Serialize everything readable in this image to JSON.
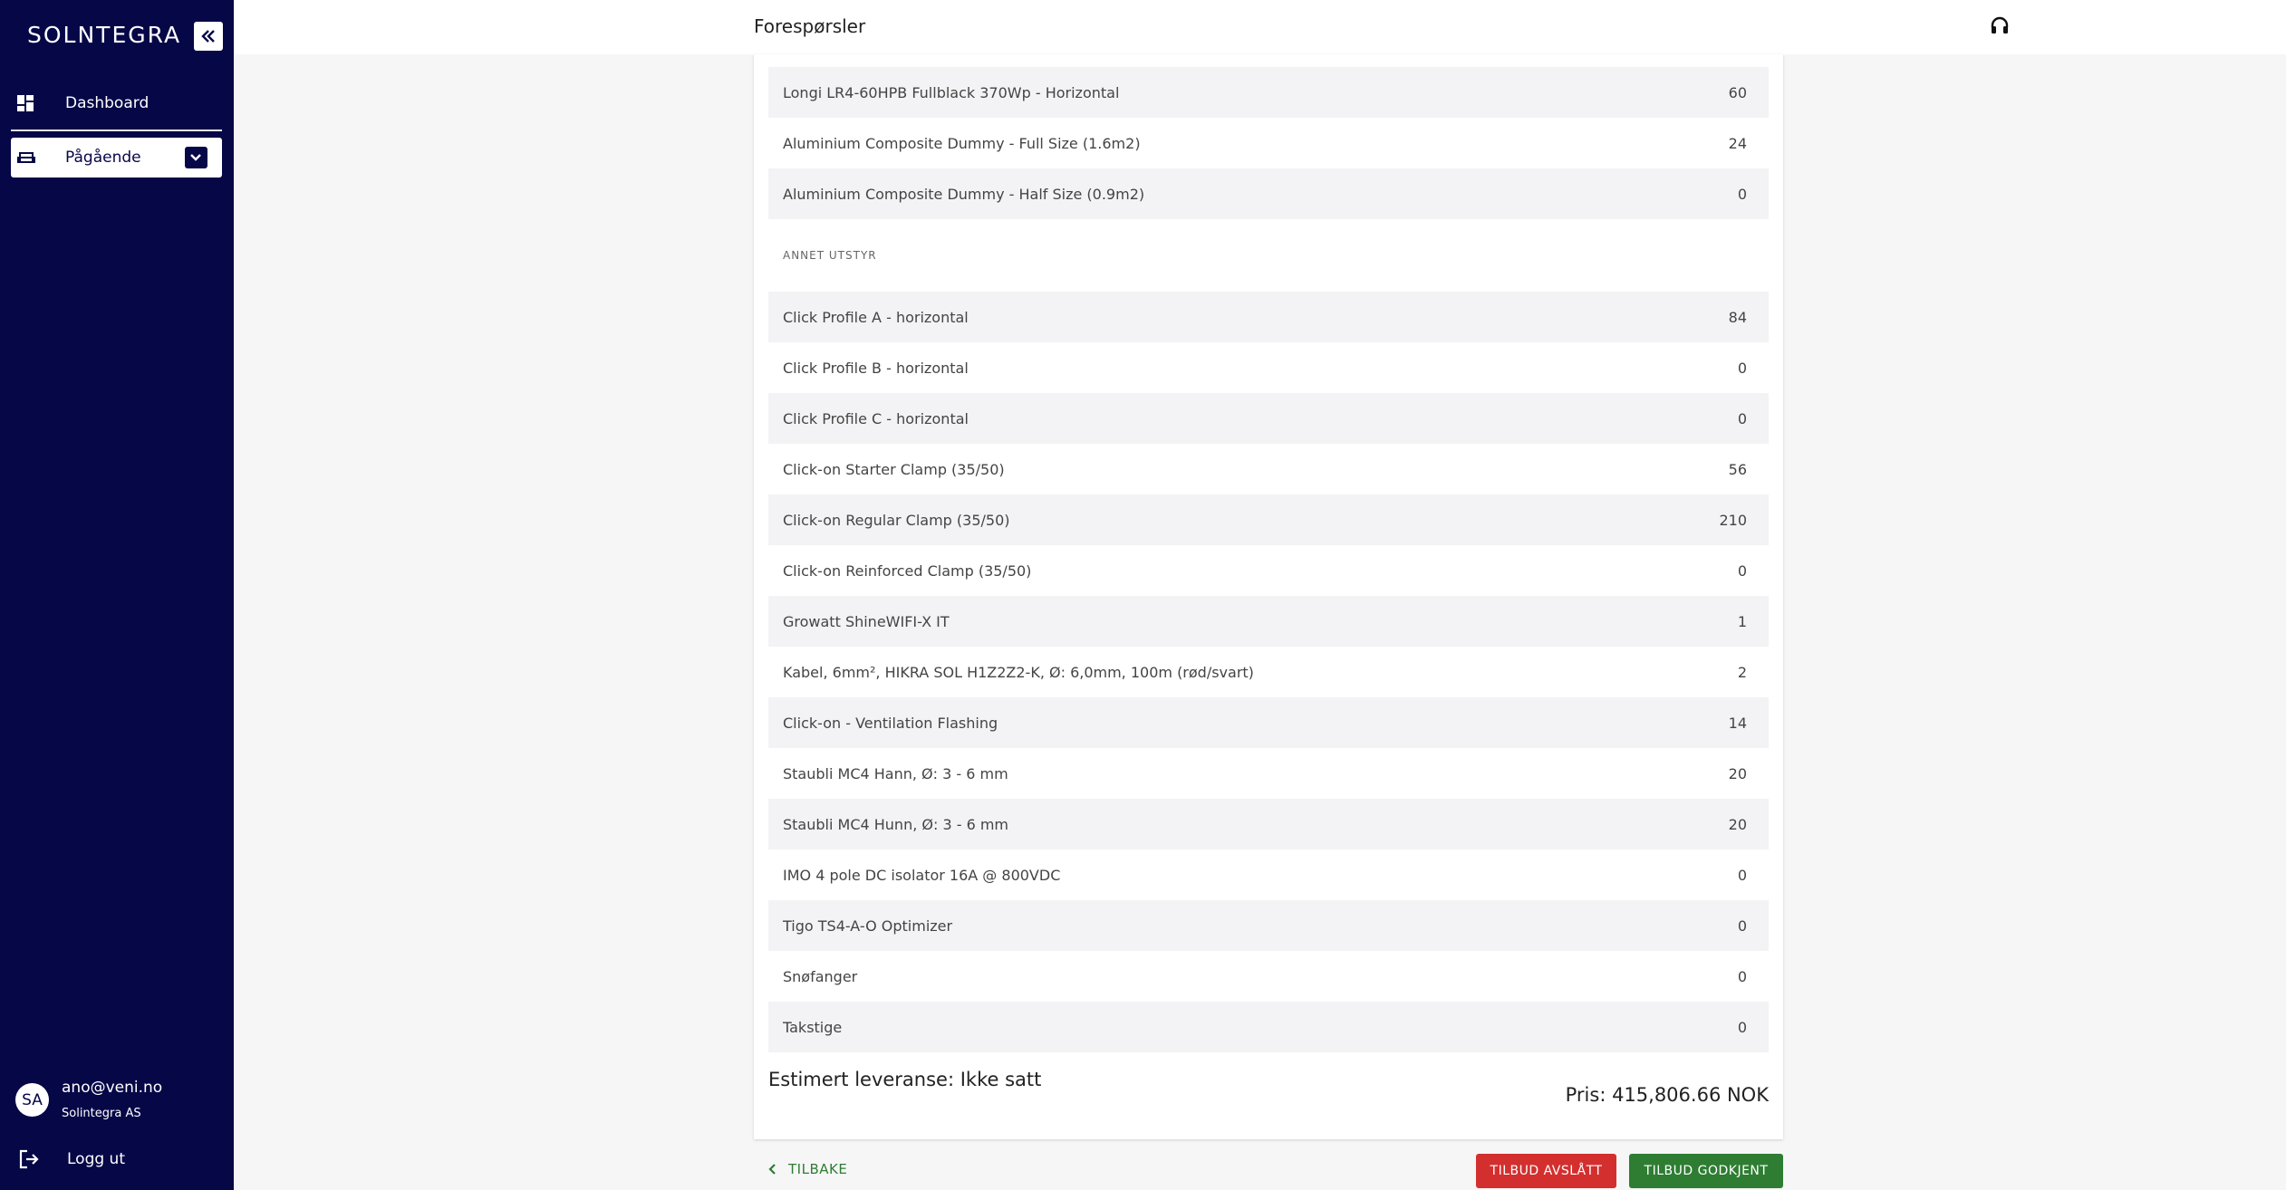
{
  "sidebar": {
    "logo": "SOLNTEGRA",
    "nav": {
      "dashboard": "Dashboard",
      "ongoing": "Pågående"
    },
    "user": {
      "initials": "SA",
      "email": "ano@veni.no",
      "company": "Solintegra AS"
    },
    "logout": "Logg ut"
  },
  "header": {
    "title": "Forespørsler"
  },
  "panels": [
    {
      "name": "Longi LR4-60HPB Fullblack 370Wp - Horizontal",
      "qty": "60"
    },
    {
      "name": "Aluminium Composite Dummy - Full Size (1.6m2)",
      "qty": "24"
    },
    {
      "name": "Aluminium Composite Dummy - Half Size (0.9m2)",
      "qty": "0"
    }
  ],
  "other_label": "ANNET UTSTYR",
  "other": [
    {
      "name": "Click Profile A - horizontal",
      "qty": "84"
    },
    {
      "name": "Click Profile B - horizontal",
      "qty": "0"
    },
    {
      "name": "Click Profile C - horizontal",
      "qty": "0"
    },
    {
      "name": "Click-on Starter Clamp (35/50)",
      "qty": "56"
    },
    {
      "name": "Click-on Regular Clamp (35/50)",
      "qty": "210"
    },
    {
      "name": "Click-on Reinforced Clamp (35/50)",
      "qty": "0"
    },
    {
      "name": "Growatt ShineWIFI-X IT",
      "qty": "1"
    },
    {
      "name": "Kabel, 6mm², HIKRA SOL H1Z2Z2-K, Ø: 6,0mm, 100m (rød/svart)",
      "qty": "2"
    },
    {
      "name": "Click-on - Ventilation Flashing",
      "qty": "14"
    },
    {
      "name": "Staubli MC4 Hann, Ø: 3 - 6 mm",
      "qty": "20"
    },
    {
      "name": "Staubli MC4 Hunn, Ø: 3 - 6 mm",
      "qty": "20"
    },
    {
      "name": "IMO 4 pole DC isolator 16A @ 800VDC",
      "qty": "0"
    },
    {
      "name": "Tigo TS4-A-O Optimizer",
      "qty": "0"
    },
    {
      "name": "Snøfanger",
      "qty": "0"
    },
    {
      "name": "Takstige",
      "qty": "0"
    }
  ],
  "summary": {
    "delivery": "Estimert leveranse: Ikke satt",
    "price": "Pris: 415,806.66 NOK"
  },
  "actions": {
    "back": "TILBAKE",
    "reject": "TILBUD AVSLÅTT",
    "approve": "TILBUD GODKJENT"
  },
  "colors": {
    "sidebar": "#060747",
    "reject": "#d32f2f",
    "approve": "#2e7d32",
    "row_shade": "#f3f3f5"
  },
  "icons": [
    "collapse-icon",
    "dashboard-icon",
    "sofa-icon",
    "chevron-down-icon",
    "headset-icon",
    "logout-icon",
    "chevron-left-icon"
  ]
}
